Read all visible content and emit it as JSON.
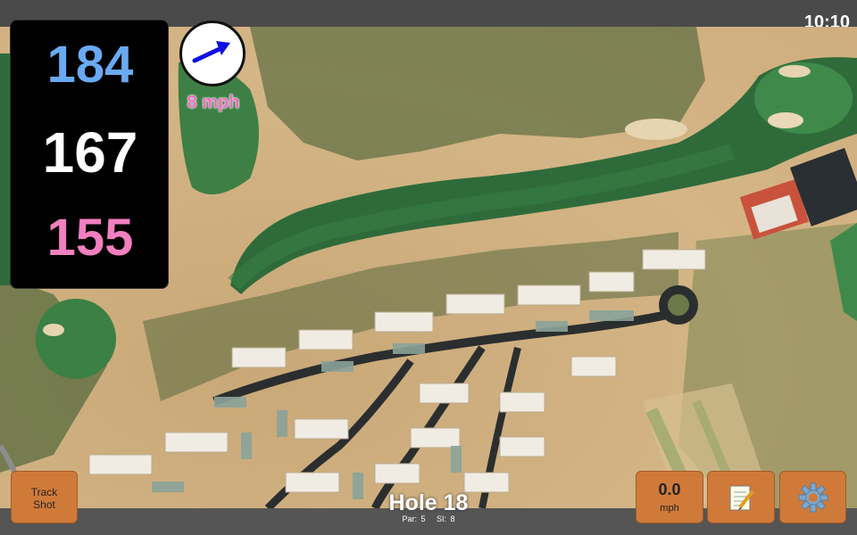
{
  "status": {
    "time": "10:10"
  },
  "distances": {
    "back": "184",
    "middle": "167",
    "front": "155"
  },
  "wind": {
    "speed_label": "8 mph",
    "direction_icon": "arrow-up-right-icon"
  },
  "hole": {
    "title": "Hole 18",
    "par": "Par: 5",
    "si": "SI: 8"
  },
  "buttons": {
    "track_shot_line1": "Track",
    "track_shot_line2": "Shot",
    "speed_value": "0.0",
    "speed_unit": "mph",
    "notes_icon": "notepad-icon",
    "settings_icon": "gear-icon"
  },
  "colors": {
    "back_distance": "#6aaaf2",
    "middle_distance": "#ffffff",
    "front_distance": "#f27fbf",
    "wind_speed": "#f06ec0",
    "button_bg": "#d07a3a"
  }
}
